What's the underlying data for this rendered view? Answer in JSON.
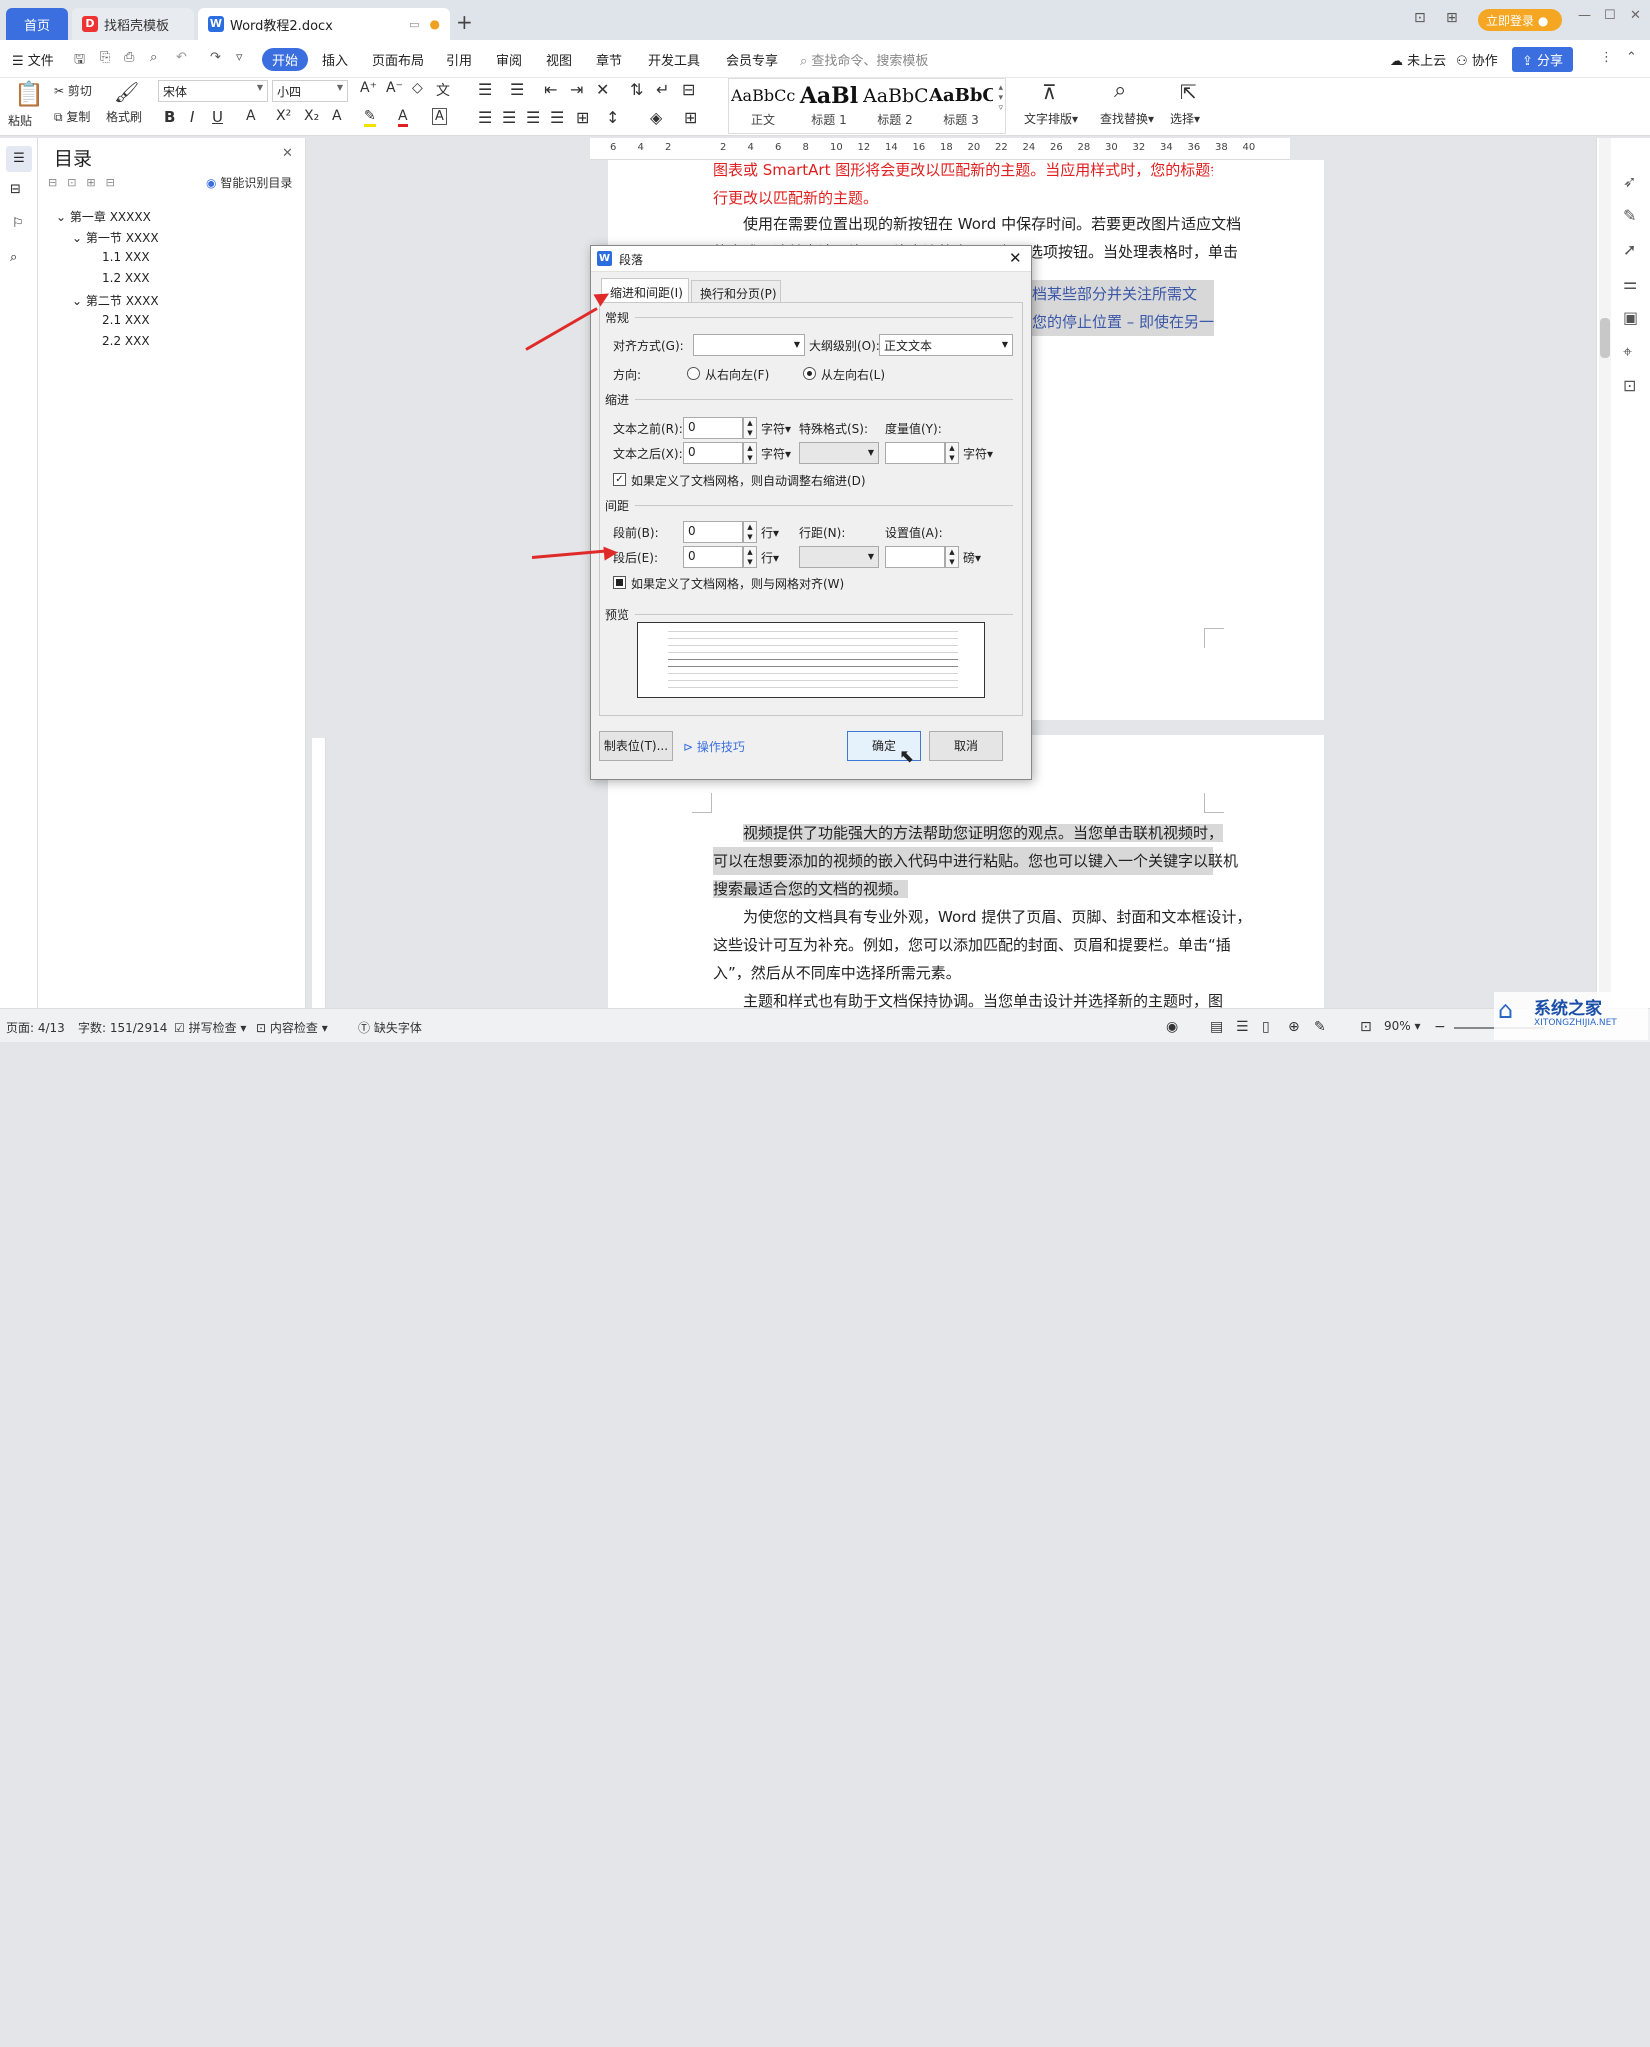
{
  "tabs": {
    "home": "首页",
    "template": "找稻壳模板",
    "doc": "Word教程2.docx",
    "new_tab": "+"
  },
  "titlebar": {
    "login": "立即登录"
  },
  "menu": {
    "file": "文件",
    "start": "开始",
    "insert": "插入",
    "layout": "页面布局",
    "reference": "引用",
    "review": "审阅",
    "view": "视图",
    "chapter": "章节",
    "dev": "开发工具",
    "member": "会员专享",
    "search": "查找命令、搜索模板",
    "cloud": "未上云",
    "collab": "协作",
    "share": "分享"
  },
  "ribbon": {
    "paste": "粘贴",
    "cut": "剪切",
    "copy": "复制",
    "format_painter": "格式刷",
    "font": "宋体",
    "size": "小四",
    "styles": [
      {
        "sample": "AaBbCcI",
        "label": "正文"
      },
      {
        "sample": "AaBl",
        "label": "标题 1"
      },
      {
        "sample": "AaBbC",
        "label": "标题 2"
      },
      {
        "sample": "AaBbC",
        "label": "标题 3"
      }
    ],
    "text_layout": "文字排版",
    "find_replace": "查找替换",
    "select": "选择"
  },
  "toc": {
    "title": "目录",
    "smart": "智能识别目录",
    "items": [
      {
        "label": "第一章 XXXXX"
      },
      {
        "label": "第一节 XXXX"
      },
      {
        "label": "1.1 XXX"
      },
      {
        "label": "1.2 XXX"
      },
      {
        "label": "第二节 XXXX"
      },
      {
        "label": "2.1 XXX"
      },
      {
        "label": "2.2 XXX"
      }
    ]
  },
  "ruler": {
    "ticks": [
      "6",
      "4",
      "2",
      "",
      "2",
      "4",
      "6",
      "8",
      "10",
      "12",
      "14",
      "16",
      "18",
      "20",
      "22",
      "24",
      "26",
      "28",
      "30",
      "32",
      "34",
      "36",
      "38",
      "40"
    ]
  },
  "page1": {
    "red_line1": "图表或 SmartArt 图形将会更改以匹配新的主题。当应用样式时，您的标题会进",
    "red_line2": "行更改以匹配新的主题。",
    "p2_line1": "使用在需要位置出现的新按钮在 Word 中保存时间。若要更改图片适应文档",
    "p2_line2": "的方式，请单击该图片，图片旁边将会显示布局选项按钮。当处理表格时，单击",
    "p3_line1_tail": "档某些部分并关注所需文本。",
    "p3_line2_tail": "您的停止位置 – 即使在另一"
  },
  "page2": {
    "l1": "视频提供了功能强大的方法帮助您证明您的观点。当您单击联机视频时，",
    "l2": "可以在想要添加的视频的嵌入代码中进行粘贴。您也可以键入一个关键字以联机",
    "l3": "搜索最适合您的文档的视频。",
    "l4": "为使您的文档具有专业外观，Word 提供了页眉、页脚、封面和文本框设计，",
    "l5": "这些设计可互为补充。例如，您可以添加匹配的封面、页眉和提要栏。单击“插",
    "l6": "入”，然后从不同库中选择所需元素。",
    "l7": "主题和样式也有助于文档保持协调。当您单击设计并选择新的主题时，图"
  },
  "dialog": {
    "title": "段落",
    "tab1": "缩进和间距(I)",
    "tab2": "换行和分页(P)",
    "sec_general": "常规",
    "align_label": "对齐方式(G):",
    "align_value": "",
    "outline_label": "大纲级别(O):",
    "outline_value": "正文文本",
    "direction_label": "方向:",
    "rtl": "从右向左(F)",
    "ltr": "从左向右(L)",
    "sec_indent": "缩进",
    "before_text": "文本之前(R):",
    "before_val": "0",
    "char_unit": "字符",
    "special": "特殊格式(S):",
    "measure": "度量值(Y):",
    "after_text": "文本之后(X):",
    "after_val": "0",
    "special_val": "",
    "measure_val": "",
    "grid_indent": "如果定义了文档网格，则自动调整右缩进(D)",
    "sec_spacing": "间距",
    "before_para": "段前(B):",
    "before_para_val": "0",
    "line_unit": "行",
    "line_spacing": "行距(N):",
    "set_value": "设置值(A):",
    "after_para": "段后(E):",
    "after_para_val": "0",
    "line_spacing_val": "",
    "set_value_val": "",
    "pt_unit": "磅",
    "grid_align": "如果定义了文档网格，则与网格对齐(W)",
    "sec_preview": "预览",
    "tabs_btn": "制表位(T)...",
    "tips": "操作技巧",
    "ok": "确定",
    "cancel": "取消"
  },
  "status": {
    "page": "页面: 4/13",
    "words": "字数: 151/2914",
    "spell": "拼写检查",
    "content": "内容检查",
    "missing_font": "缺失字体",
    "zoom": "90%"
  },
  "watermark": {
    "name": "系统之家",
    "url": "XITONGZHIJIA.NET"
  }
}
